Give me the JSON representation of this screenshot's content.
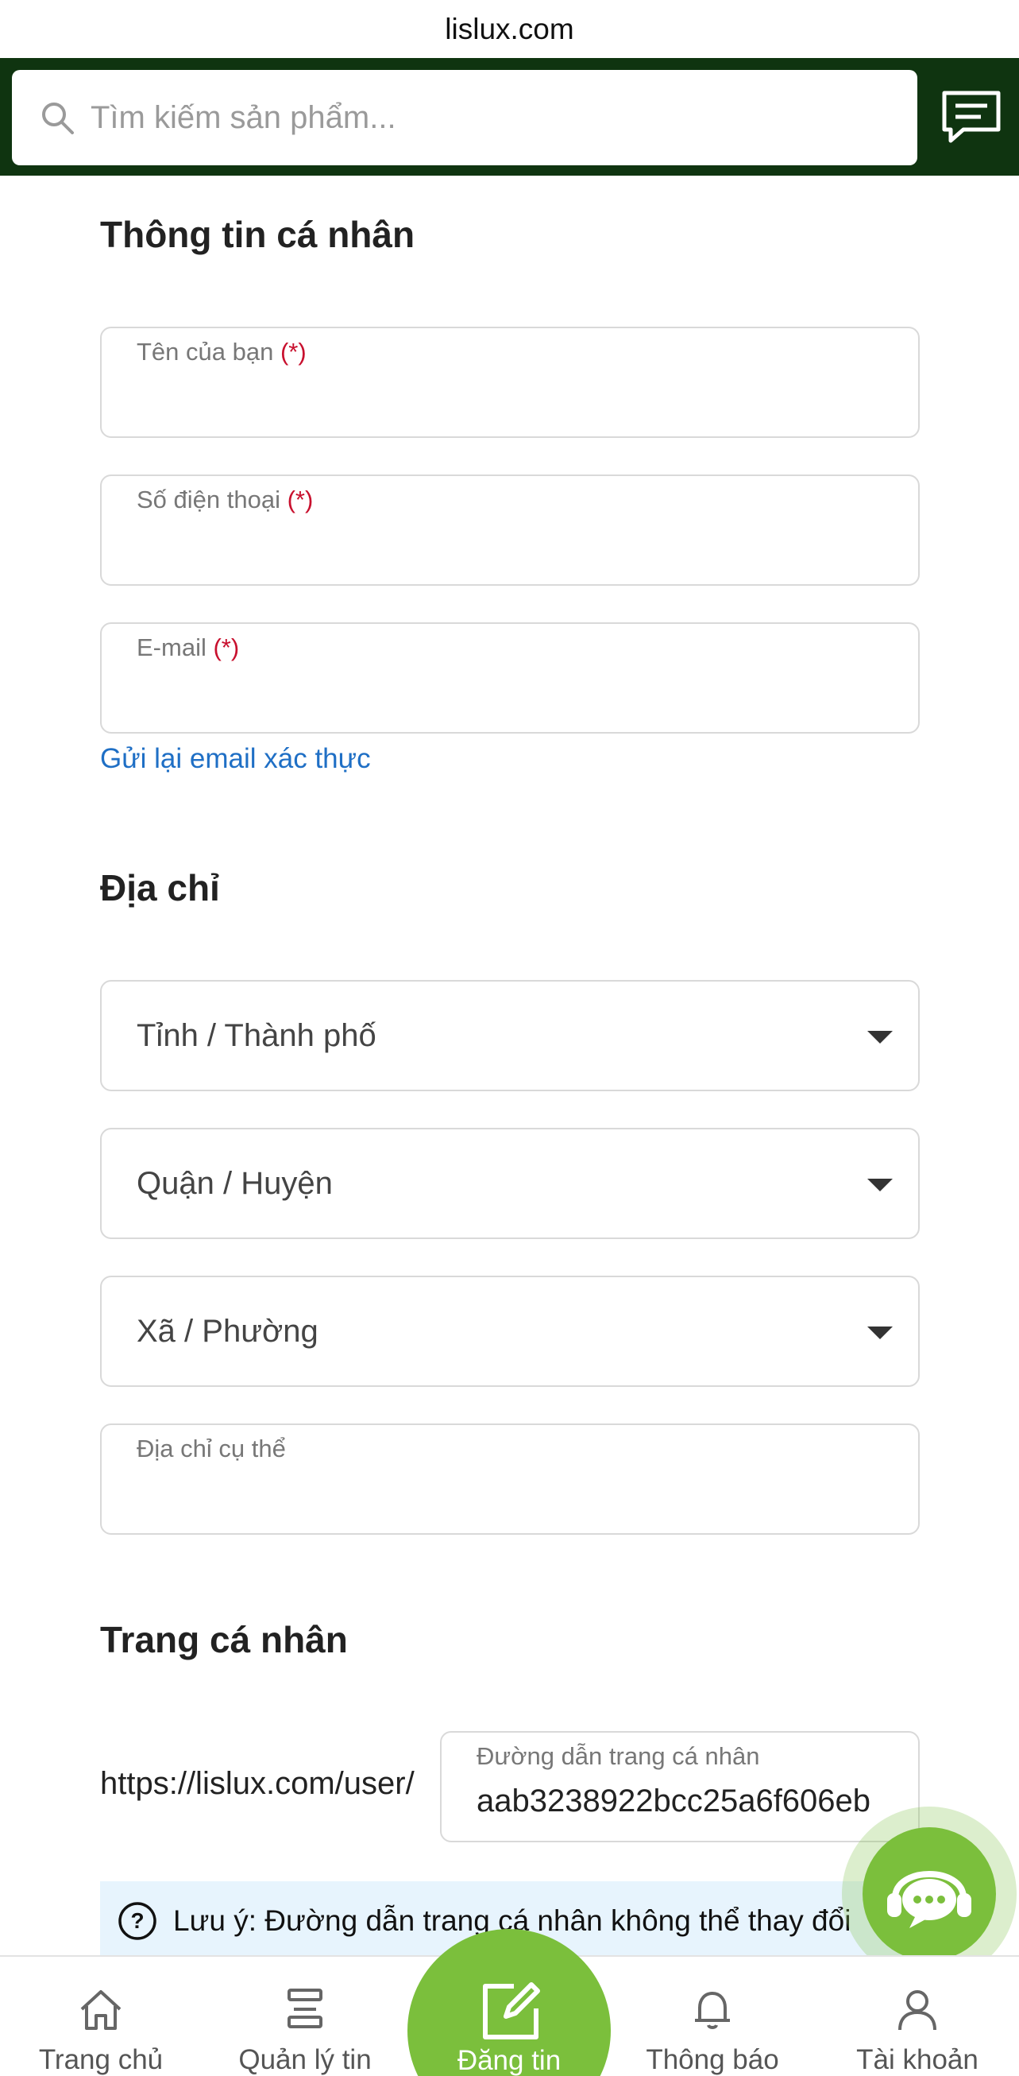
{
  "browser": {
    "url": "lislux.com"
  },
  "header": {
    "search_placeholder": "Tìm kiếm sản phẩm...",
    "chat_icon": "message-icon"
  },
  "personal": {
    "title": "Thông tin cá nhân",
    "name_label": "Tên của bạn",
    "phone_label": "Số điện thoại",
    "email_label": "E-mail",
    "required_mark": "(*)",
    "name_value": "",
    "phone_value": "",
    "email_value": "",
    "resend_link": "Gửi lại email xác thực"
  },
  "address": {
    "title": "Địa chỉ",
    "province": "Tỉnh / Thành phố",
    "district": "Quận / Huyện",
    "ward": "Xã / Phường",
    "detail_label": "Địa chỉ cụ thể",
    "detail_value": ""
  },
  "profile": {
    "title": "Trang cá nhân",
    "url_prefix": "https://lislux.com/user/",
    "slug_label": "Đường dẫn trang cá nhân",
    "slug_value": "aab3238922bcc25a6f606eb",
    "note": "Lưu ý: Đường dẫn trang cá nhân không thể thay đổi"
  },
  "nav": {
    "home": "Trang chủ",
    "manage": "Quản lý tin",
    "post": "Đăng tin",
    "notifications": "Thông báo",
    "account": "Tài khoản"
  },
  "colors": {
    "header_bg": "#0f3410",
    "accent_green": "#7bbf3c",
    "link_blue": "#1f6fc5",
    "required_red": "#c8102e",
    "note_bg": "#e7f4fd"
  }
}
